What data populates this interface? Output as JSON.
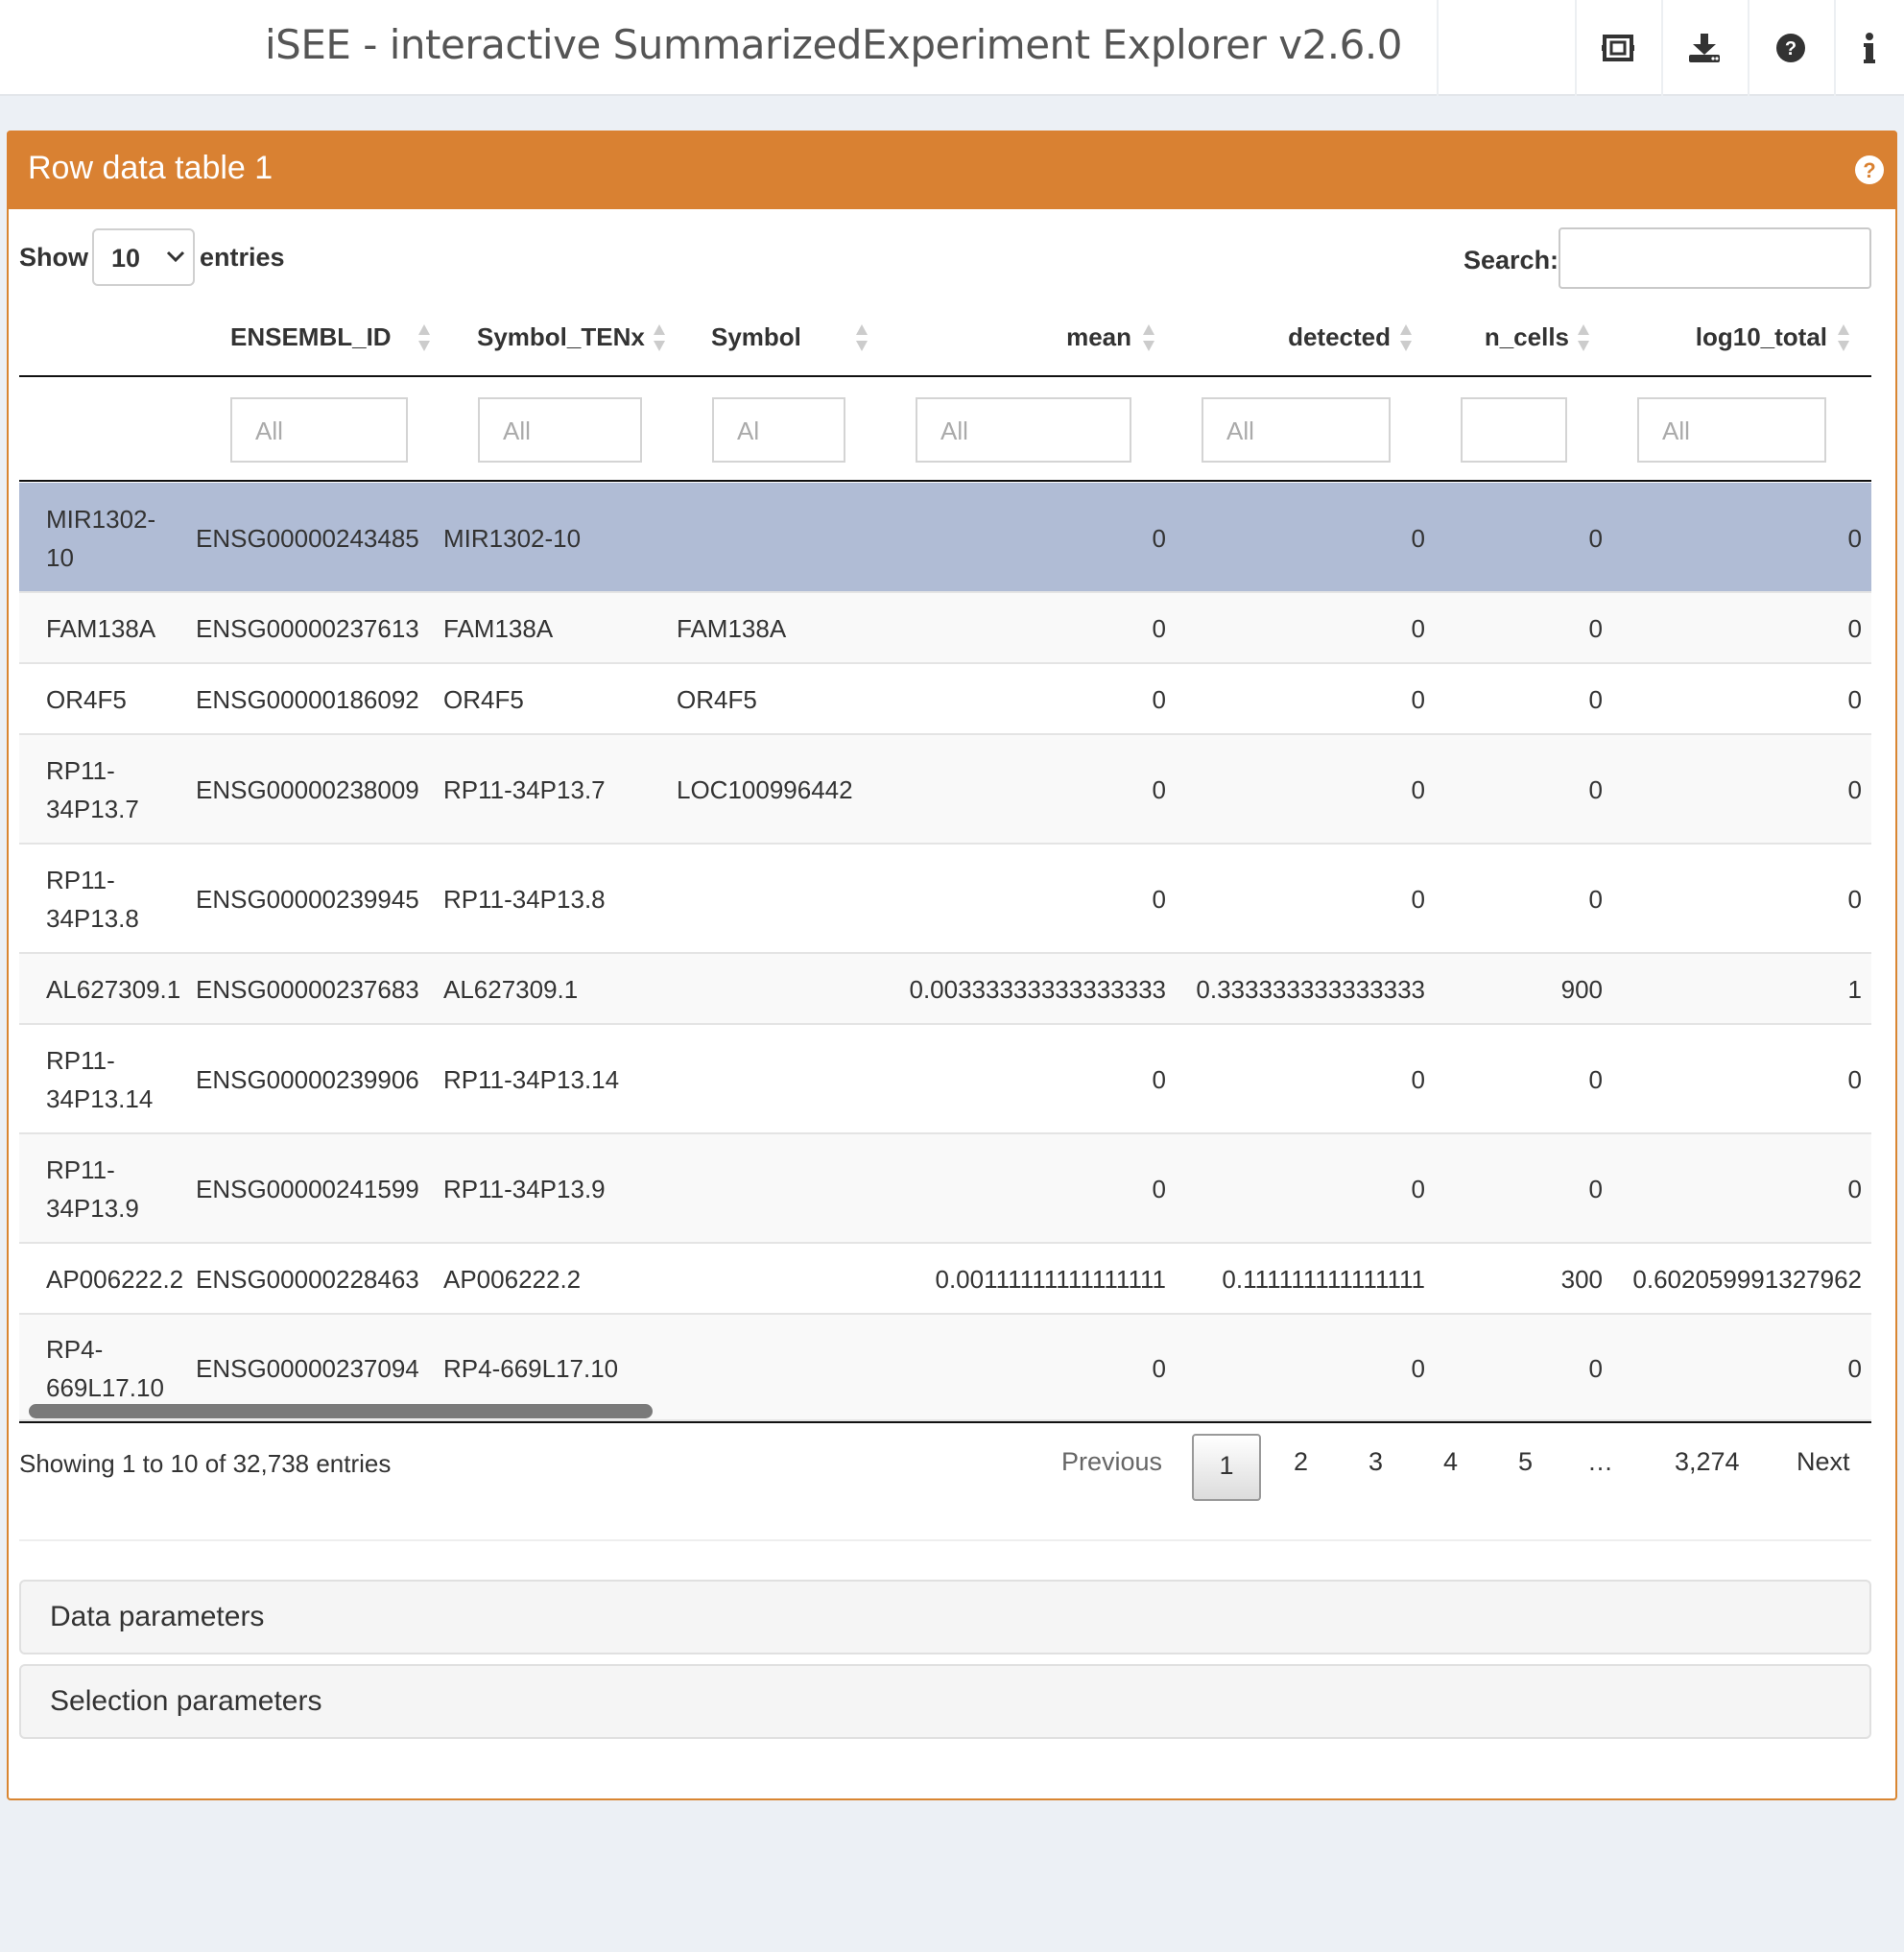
{
  "header": {
    "title": "iSEE - interactive SummarizedExperiment Explorer v2.6.0",
    "icons": [
      "screenshot-icon",
      "download-icon",
      "help-icon",
      "info-icon"
    ]
  },
  "panel": {
    "title": "Row data table 1",
    "accent": "#d98132"
  },
  "controls": {
    "show_label": "Show",
    "length_value": "10",
    "entries_label": "entries",
    "search_label": "Search:",
    "search_value": ""
  },
  "table": {
    "columns": [
      "ENSEMBL_ID",
      "Symbol_TENx",
      "Symbol",
      "mean",
      "detected",
      "n_cells",
      "log10_total"
    ],
    "filters": [
      "All",
      "All",
      "Al",
      "All",
      "All",
      "",
      "All"
    ],
    "rows": [
      {
        "name_1": "MIR1302-",
        "name_2": "10",
        "ensembl": "ENSG00000243485",
        "symbol_tenx": "MIR1302-10",
        "symbol": "",
        "mean": "0",
        "detected": "0",
        "n_cells": "0",
        "log10_total": "0",
        "selected": true
      },
      {
        "name_1": "FAM138A",
        "name_2": "",
        "ensembl": "ENSG00000237613",
        "symbol_tenx": "FAM138A",
        "symbol": "FAM138A",
        "mean": "0",
        "detected": "0",
        "n_cells": "0",
        "log10_total": "0"
      },
      {
        "name_1": "OR4F5",
        "name_2": "",
        "ensembl": "ENSG00000186092",
        "symbol_tenx": "OR4F5",
        "symbol": "OR4F5",
        "mean": "0",
        "detected": "0",
        "n_cells": "0",
        "log10_total": "0"
      },
      {
        "name_1": "RP11-",
        "name_2": "34P13.7",
        "ensembl": "ENSG00000238009",
        "symbol_tenx": "RP11-34P13.7",
        "symbol": "LOC100996442",
        "mean": "0",
        "detected": "0",
        "n_cells": "0",
        "log10_total": "0"
      },
      {
        "name_1": "RP11-",
        "name_2": "34P13.8",
        "ensembl": "ENSG00000239945",
        "symbol_tenx": "RP11-34P13.8",
        "symbol": "",
        "mean": "0",
        "detected": "0",
        "n_cells": "0",
        "log10_total": "0"
      },
      {
        "name_1": "AL627309.1",
        "name_2": "",
        "ensembl": "ENSG00000237683",
        "symbol_tenx": "AL627309.1",
        "symbol": "",
        "mean": "0.00333333333333333",
        "detected": "0.333333333333333",
        "n_cells": "900",
        "log10_total": "1"
      },
      {
        "name_1": "RP11-",
        "name_2": "34P13.14",
        "ensembl": "ENSG00000239906",
        "symbol_tenx": "RP11-34P13.14",
        "symbol": "",
        "mean": "0",
        "detected": "0",
        "n_cells": "0",
        "log10_total": "0"
      },
      {
        "name_1": "RP11-",
        "name_2": "34P13.9",
        "ensembl": "ENSG00000241599",
        "symbol_tenx": "RP11-34P13.9",
        "symbol": "",
        "mean": "0",
        "detected": "0",
        "n_cells": "0",
        "log10_total": "0"
      },
      {
        "name_1": "AP006222.2",
        "name_2": "",
        "ensembl": "ENSG00000228463",
        "symbol_tenx": "AP006222.2",
        "symbol": "",
        "mean": "0.00111111111111111",
        "detected": "0.111111111111111",
        "n_cells": "300",
        "log10_total": "0.602059991327962"
      },
      {
        "name_1": "RP4-",
        "name_2": "669L17.10",
        "ensembl": "ENSG00000237094",
        "symbol_tenx": "RP4-669L17.10",
        "symbol": "",
        "mean": "0",
        "detected": "0",
        "n_cells": "0",
        "log10_total": "0"
      }
    ]
  },
  "footer": {
    "info": "Showing 1 to 10 of 32,738 entries",
    "previous": "Previous",
    "pages": [
      "1",
      "2",
      "3",
      "4",
      "5"
    ],
    "ellipsis": "…",
    "last_page": "3,274",
    "next": "Next"
  },
  "sections": [
    "Data parameters",
    "Selection parameters"
  ]
}
